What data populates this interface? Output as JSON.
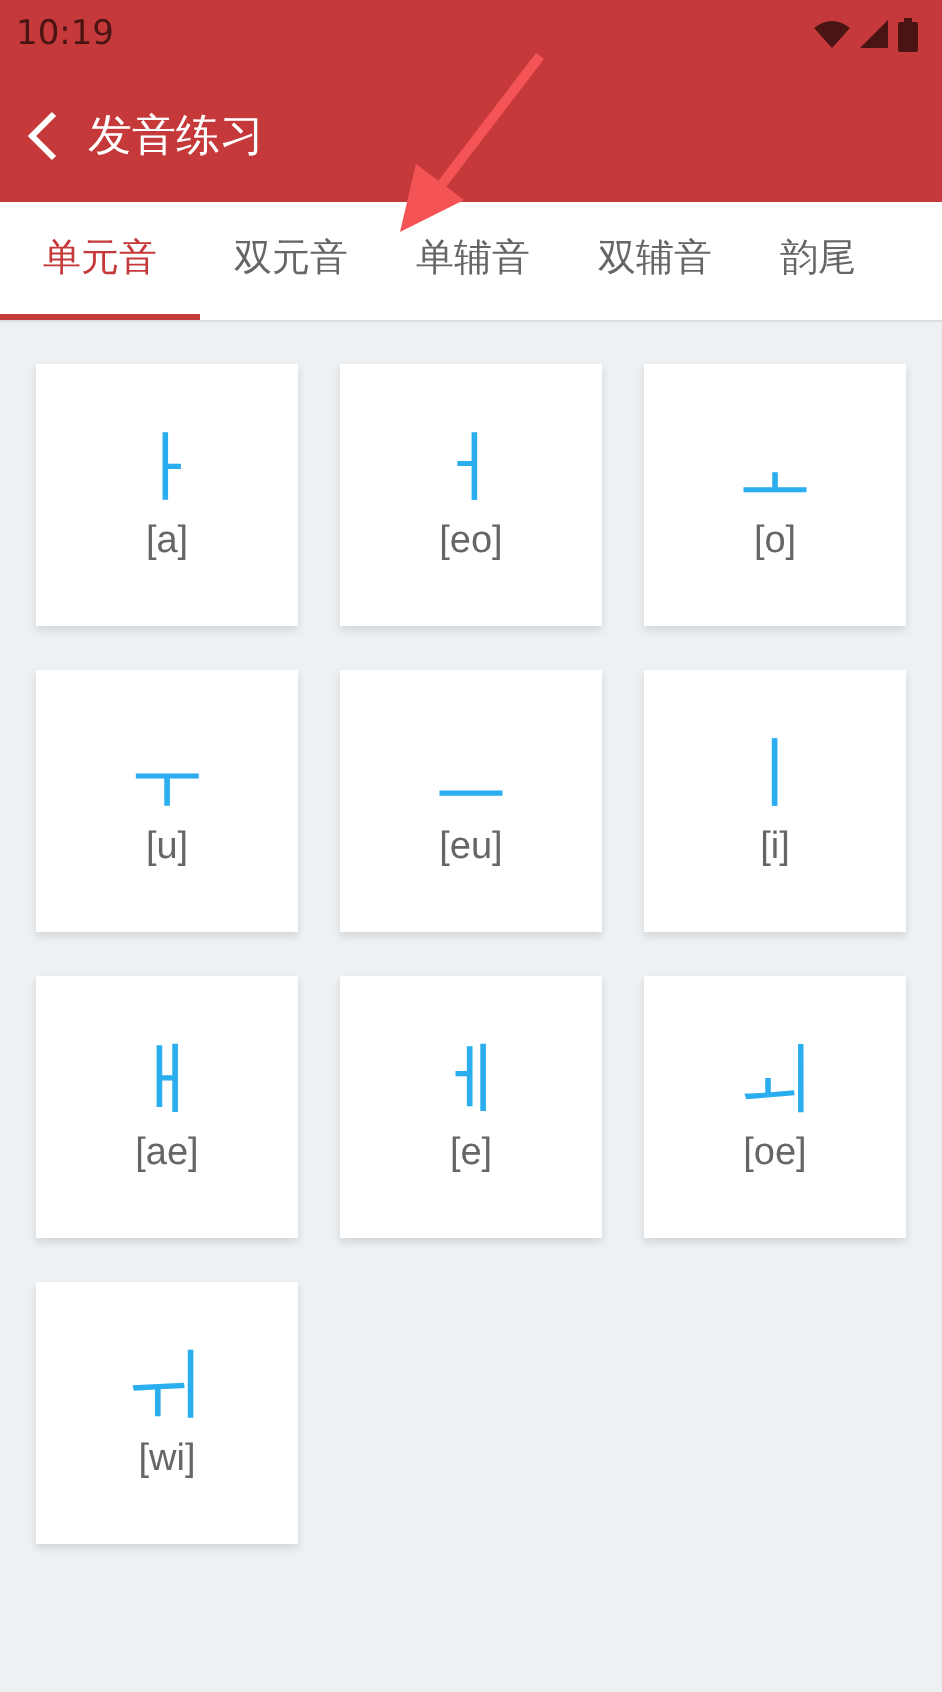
{
  "status_bar": {
    "time": "10:19"
  },
  "app_bar": {
    "title": "发音练习"
  },
  "tabs": [
    {
      "label": "单元音",
      "selected": true
    },
    {
      "label": "双元音",
      "selected": false
    },
    {
      "label": "单辅音",
      "selected": false
    },
    {
      "label": "双辅音",
      "selected": false
    },
    {
      "label": "韵尾",
      "selected": false
    }
  ],
  "cards": [
    {
      "letter": "ㅏ",
      "romanization": "[a]"
    },
    {
      "letter": "ㅓ",
      "romanization": "[eo]"
    },
    {
      "letter": "ㅗ",
      "romanization": "[o]"
    },
    {
      "letter": "ㅜ",
      "romanization": "[u]"
    },
    {
      "letter": "ㅡ",
      "romanization": "[eu]"
    },
    {
      "letter": "ㅣ",
      "romanization": "[i]"
    },
    {
      "letter": "ㅐ",
      "romanization": "[ae]"
    },
    {
      "letter": "ㅔ",
      "romanization": "[e]"
    },
    {
      "letter": "ㅚ",
      "romanization": "[oe]"
    },
    {
      "letter": "ㅟ",
      "romanization": "[wi]"
    }
  ]
}
